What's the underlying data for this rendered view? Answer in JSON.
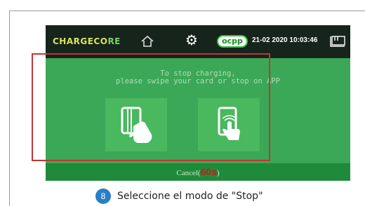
{
  "logo": {
    "text_prefix": "CHARGECO",
    "text_suffix": "RE"
  },
  "header": {
    "ocpp_label": "ocpp",
    "date": "21-02 2020",
    "time": "10:03:46"
  },
  "message": {
    "line1": "To stop charging,",
    "line2": "please swipe your card or stop on APP"
  },
  "options": [
    {
      "name": "card",
      "icon": "card-swipe-icon"
    },
    {
      "name": "app",
      "icon": "phone-tap-icon"
    }
  ],
  "cancel": {
    "label_before": "Cancel(",
    "countdown": "60s",
    "label_after": ")"
  },
  "caption": {
    "step": "8",
    "text": "Seleccione el modo de \"Stop\""
  },
  "colors": {
    "panel": "#3aa857",
    "topbar": "#16241b",
    "highlight": "#c23634",
    "step_badge": "#2a7fc4"
  }
}
